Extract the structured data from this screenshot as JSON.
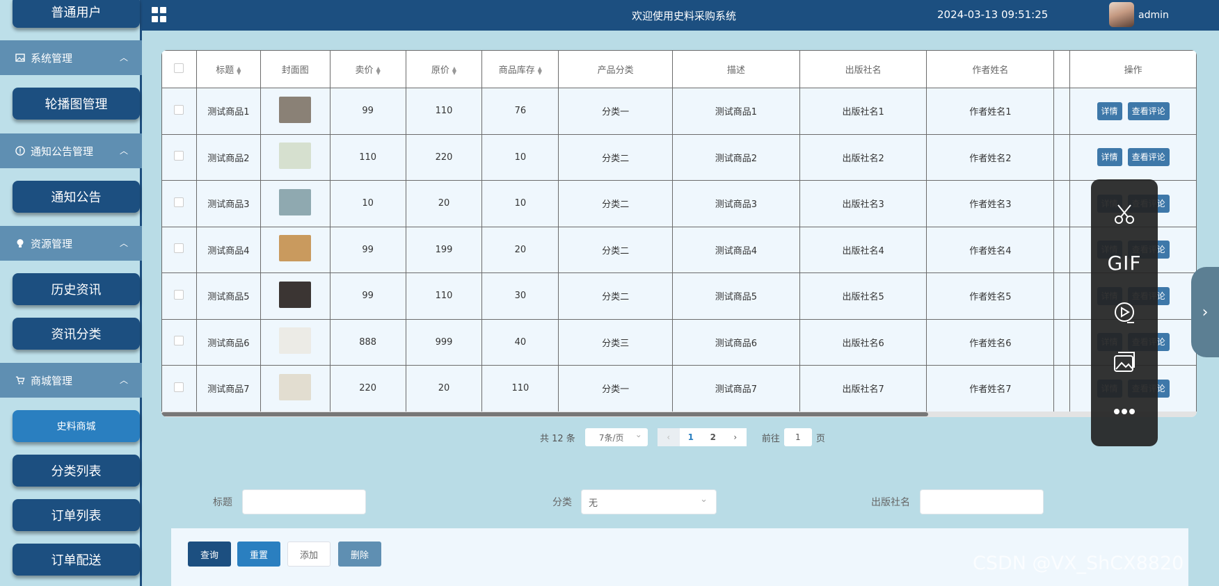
{
  "header": {
    "title": "欢迎使用史料采购系统",
    "datetime": "2024-03-13 09:51:25",
    "username": "admin"
  },
  "sidebar": {
    "top_item": "普通用户",
    "groups": [
      {
        "label": "系统管理",
        "icon": "image-icon",
        "items": [
          "轮播图管理"
        ]
      },
      {
        "label": "通知公告管理",
        "icon": "info-icon",
        "items": [
          "通知公告"
        ]
      },
      {
        "label": "资源管理",
        "icon": "bulb-icon",
        "items": [
          "历史资讯",
          "资讯分类"
        ]
      },
      {
        "label": "商城管理",
        "icon": "cart-icon",
        "items": [
          "史料商城",
          "分类列表",
          "订单列表",
          "订单配送"
        ]
      }
    ],
    "active_item": "史料商城"
  },
  "table": {
    "columns": [
      "标题",
      "封面图",
      "卖价",
      "原价",
      "商品库存",
      "产品分类",
      "描述",
      "出版社名",
      "作者姓名",
      "操作"
    ],
    "rows": [
      {
        "title": "测试商品1",
        "price": "99",
        "original": "110",
        "stock": "76",
        "category": "分类一",
        "desc": "测试商品1",
        "publisher": "出版社名1",
        "author": "作者姓名1",
        "cover_color": "#8a8176"
      },
      {
        "title": "测试商品2",
        "price": "110",
        "original": "220",
        "stock": "10",
        "category": "分类二",
        "desc": "测试商品2",
        "publisher": "出版社名2",
        "author": "作者姓名2",
        "cover_color": "#d6e0cf"
      },
      {
        "title": "测试商品3",
        "price": "10",
        "original": "20",
        "stock": "10",
        "category": "分类二",
        "desc": "测试商品3",
        "publisher": "出版社名3",
        "author": "作者姓名3",
        "cover_color": "#8fa9b0"
      },
      {
        "title": "测试商品4",
        "price": "99",
        "original": "199",
        "stock": "20",
        "category": "分类二",
        "desc": "测试商品4",
        "publisher": "出版社名4",
        "author": "作者姓名4",
        "cover_color": "#c99a5e"
      },
      {
        "title": "测试商品5",
        "price": "99",
        "original": "110",
        "stock": "30",
        "category": "分类二",
        "desc": "测试商品5",
        "publisher": "出版社名5",
        "author": "作者姓名5",
        "cover_color": "#3b3533"
      },
      {
        "title": "测试商品6",
        "price": "888",
        "original": "999",
        "stock": "40",
        "category": "分类三",
        "desc": "测试商品6",
        "publisher": "出版社名6",
        "author": "作者姓名6",
        "cover_color": "#ecebe6"
      },
      {
        "title": "测试商品7",
        "price": "220",
        "original": "20",
        "stock": "110",
        "category": "分类一",
        "desc": "测试商品7",
        "publisher": "出版社名7",
        "author": "作者姓名7",
        "cover_color": "#e2ddd0"
      }
    ],
    "detail_label": "详情",
    "review_label": "查看评论"
  },
  "pagination": {
    "total": "共 12 条",
    "page_size": "7条/页",
    "pages": [
      "1",
      "2"
    ],
    "current_page": "1",
    "goto_label": "前往",
    "goto_value": "1",
    "page_unit": "页"
  },
  "search": {
    "title_label": "标题",
    "title_value": "",
    "category_label": "分类",
    "category_value": "无",
    "publisher_label": "出版社名",
    "publisher_value": ""
  },
  "actions": {
    "query": "查询",
    "reset": "重置",
    "add": "添加",
    "delete": "删除"
  },
  "colors": {
    "header_bg": "#1c4f80",
    "page_bg": "#b9dce6",
    "sidebar_button": "#1c4f80",
    "active_button": "#2a7fc0",
    "query_button": "#1c4f80",
    "reset_button": "#2a7fc0",
    "delete_button": "#5f8fb2"
  },
  "tool_panel": {
    "gif_label": "GIF",
    "icons": [
      "scissors-icon",
      "gif-icon",
      "record-video-icon",
      "screenshot-image-icon",
      "more-icon"
    ]
  },
  "watermark": "CSDN @VX_ShCX8820"
}
